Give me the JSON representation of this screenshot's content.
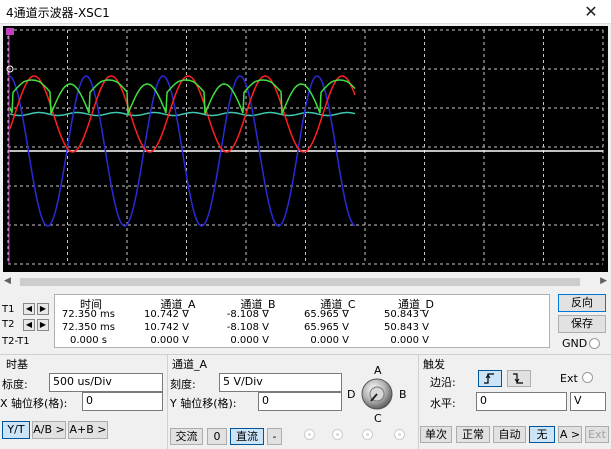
{
  "window": {
    "title": "4通道示波器-XSC1",
    "close_glyph": "✕"
  },
  "scope": {
    "colors": {
      "grid": "#c8c8c8",
      "trace": "#ffffff",
      "channel_a": "#ff2020",
      "channel_b": "#2a2ad8",
      "channel_c": "#40e040",
      "channel_d": "#40c8b0"
    },
    "markers": {
      "t1_label": "T1",
      "t2_label": "T2"
    }
  },
  "readout": {
    "row_labels": [
      "T1",
      "T2",
      "T2-T1"
    ],
    "headers": [
      "时间",
      "通道_A",
      "通道_B",
      "通道_C",
      "通道_D"
    ],
    "rows": [
      [
        "72.350 ms",
        "10.742 V",
        "-8.108 V",
        "65.965 V",
        "50.843 V"
      ],
      [
        "72.350 ms",
        "10.742 V",
        "-8.108 V",
        "65.965 V",
        "50.843 V"
      ],
      [
        "0.000 s",
        "0.000 V",
        "0.000 V",
        "0.000 V",
        "0.000 V"
      ]
    ],
    "reverse_label": "反向",
    "save_label": "保存",
    "gnd_label": "GND"
  },
  "timebase": {
    "title": "时基",
    "scale_label": "标度:",
    "scale_value": "500 us/Div",
    "xpos_label": "X 轴位移(格):",
    "xpos_value": "0",
    "mode_buttons": [
      "Y/T",
      "A/B >",
      "A+B >"
    ]
  },
  "channel": {
    "title": "通道_A",
    "scale_label": "刻度:",
    "scale_value": "5  V/Div",
    "ypos_label": "Y 轴位移(格):",
    "ypos_value": "0",
    "coupling_buttons": [
      "交流",
      "0",
      "直流",
      "-"
    ]
  },
  "knob": {
    "labels": [
      "A",
      "B",
      "C",
      "D"
    ]
  },
  "trigger": {
    "title": "触发",
    "edge_label": "边沿:",
    "ext_label": "Ext",
    "level_label": "水平:",
    "level_value": "0",
    "level_unit": "V",
    "mode_buttons": [
      "单次",
      "正常",
      "自动",
      "无",
      "A >",
      "Ext"
    ]
  }
}
